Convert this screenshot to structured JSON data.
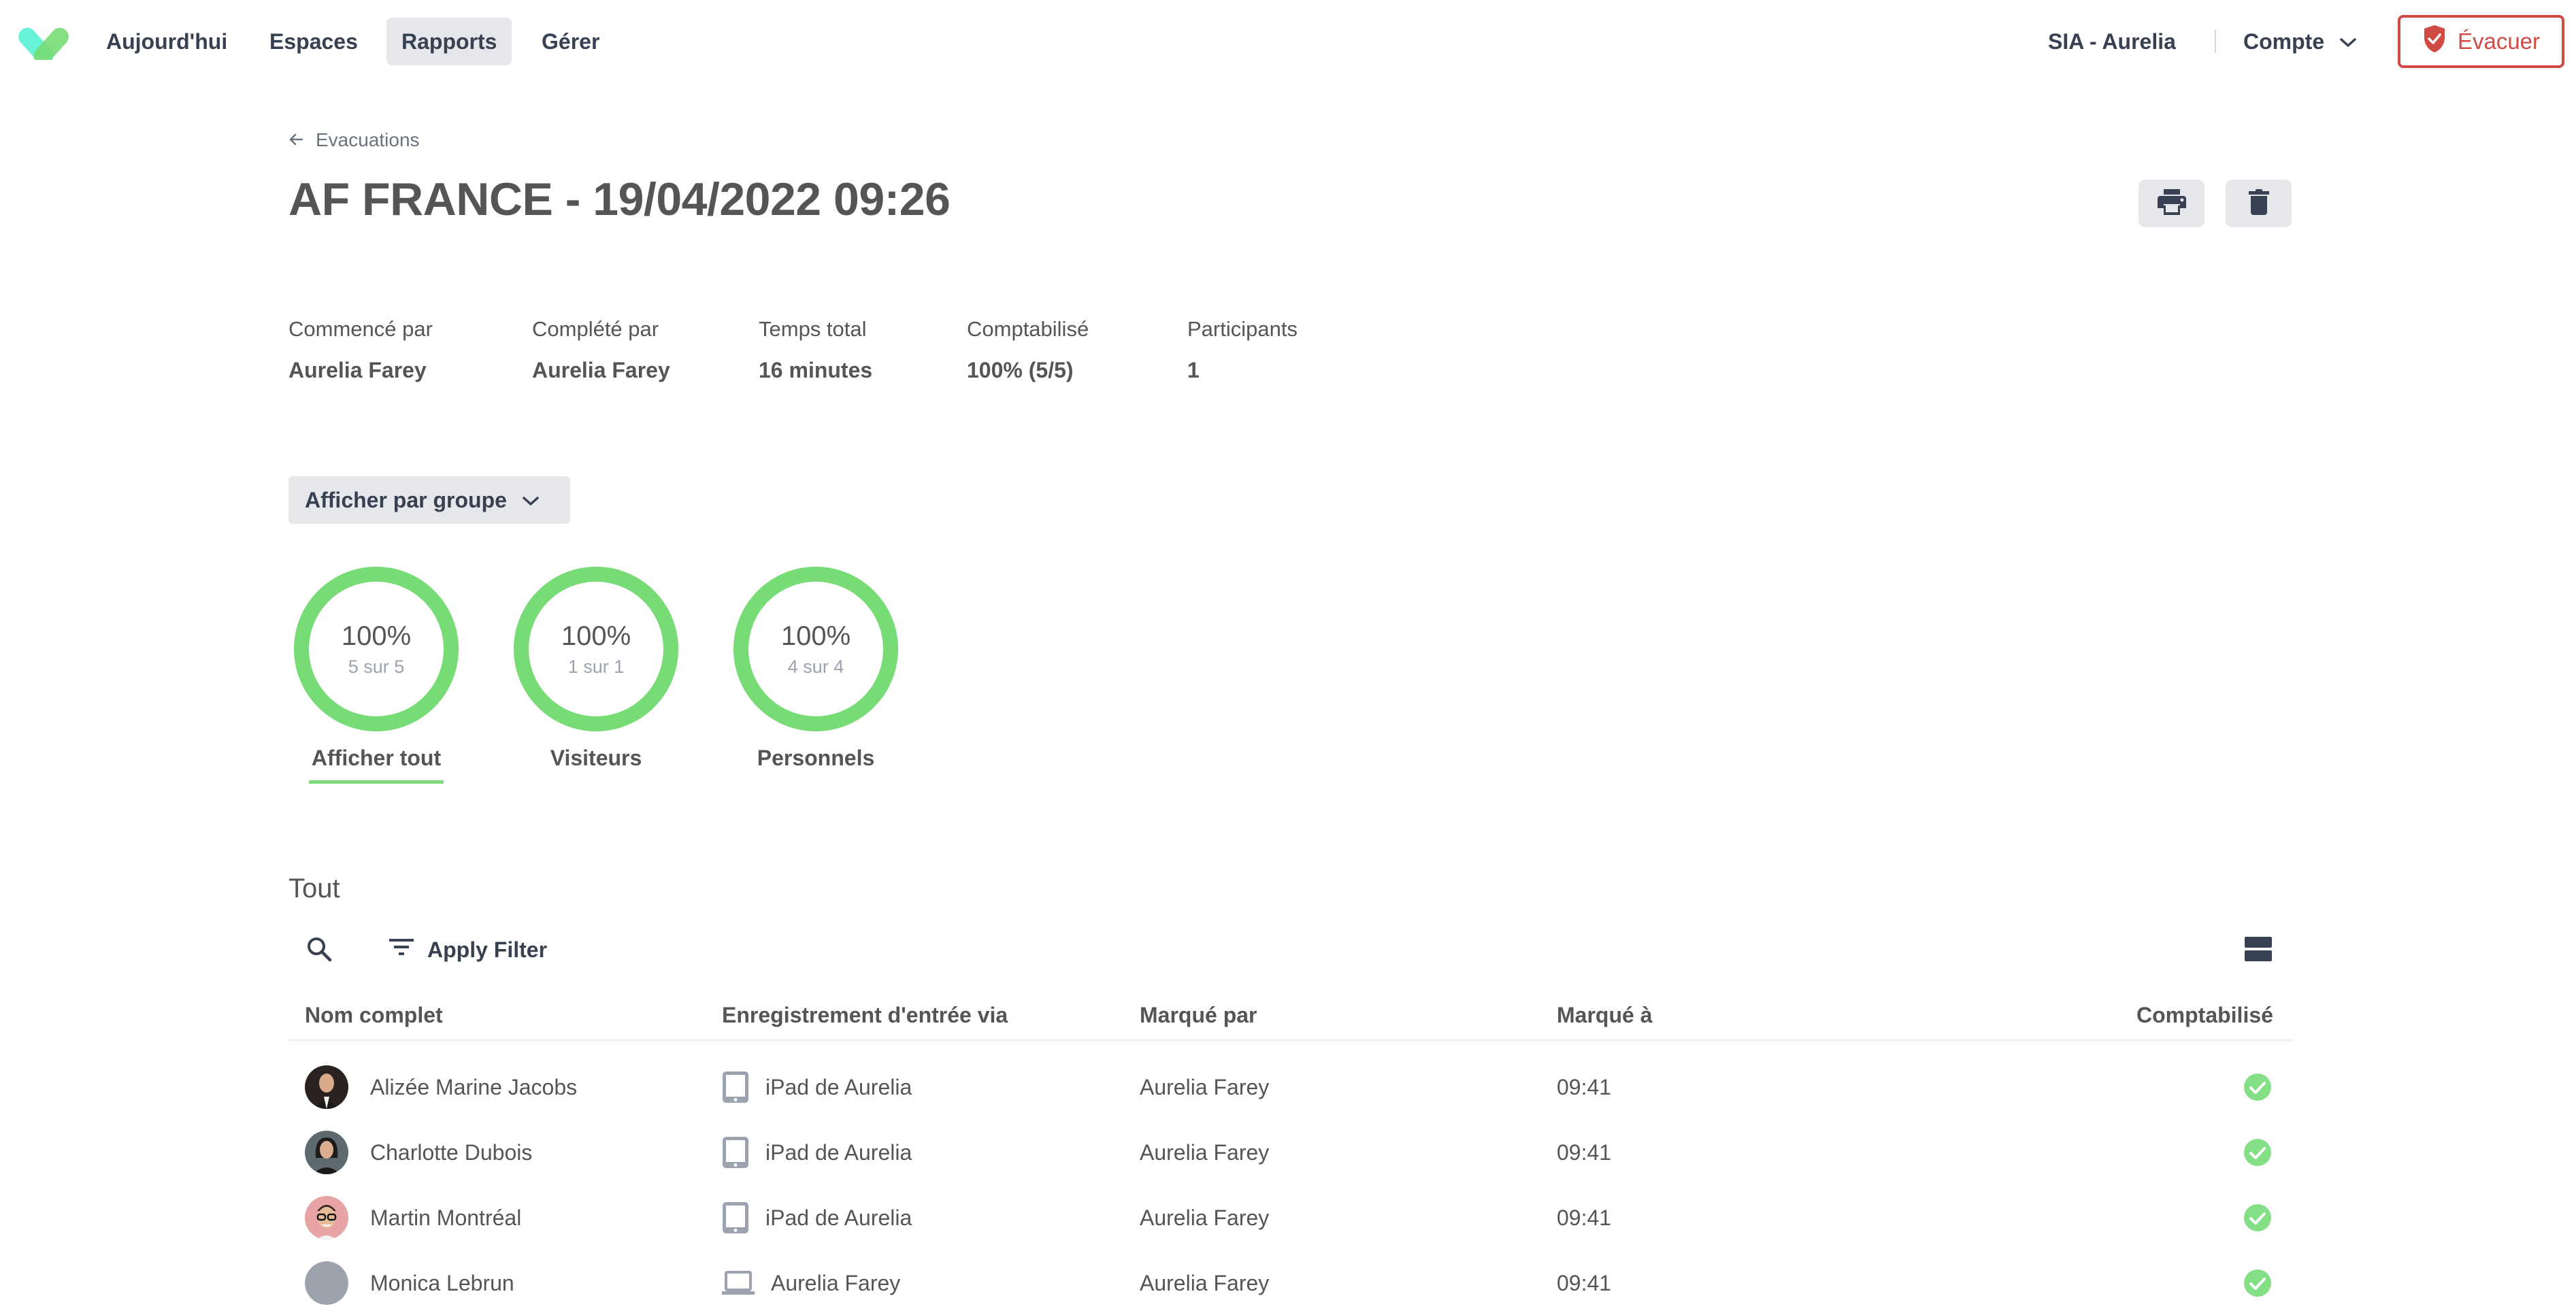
{
  "nav": {
    "logo": "app-logo",
    "items": [
      {
        "label": "Aujourd'hui",
        "active": false
      },
      {
        "label": "Espaces",
        "active": false
      },
      {
        "label": "Rapports",
        "active": true
      },
      {
        "label": "Gérer",
        "active": false
      }
    ],
    "org_name": "SIA - Aurelia",
    "account_label": "Compte",
    "evacuate_label": "Évacuer",
    "evacuate_color": "#d14b45"
  },
  "header": {
    "breadcrumb": "Evacuations",
    "title": "AF FRANCE - 19/04/2022 09:26",
    "actions": [
      "print-icon",
      "trash-icon"
    ]
  },
  "stats": [
    {
      "label": "Commencé par",
      "value": "Aurelia Farey"
    },
    {
      "label": "Complété par",
      "value": "Aurelia Farey"
    },
    {
      "label": "Temps total",
      "value": "16 minutes"
    },
    {
      "label": "Comptabilisé",
      "value": "100% (5/5)"
    },
    {
      "label": "Participants",
      "value": "1"
    }
  ],
  "group_dropdown": {
    "label": "Afficher par groupe"
  },
  "groups": [
    {
      "label": "Afficher tout",
      "percent": "100%",
      "count": "5 sur 5",
      "progress": 1.0,
      "selected": true
    },
    {
      "label": "Visiteurs",
      "percent": "100%",
      "count": "1 sur 1",
      "progress": 1.0,
      "selected": false
    },
    {
      "label": "Personnels",
      "percent": "100%",
      "count": "4 sur 4",
      "progress": 1.0,
      "selected": false
    }
  ],
  "accent_green": "#77dc75",
  "table": {
    "title": "Tout",
    "filter_label": "Apply Filter",
    "columns": [
      "Nom complet",
      "Enregistrement d'entrée via",
      "Marqué par",
      "Marqué à",
      "Comptabilisé"
    ],
    "rows": [
      {
        "name": "Alizée Marine Jacobs",
        "avatar": "photo",
        "device_icon": "tablet-icon",
        "device": "iPad de Aurelia",
        "marked_by": "Aurelia Farey",
        "marked_at": "09:41",
        "accounted": true
      },
      {
        "name": "Charlotte Dubois",
        "avatar": "photo",
        "device_icon": "tablet-icon",
        "device": "iPad de Aurelia",
        "marked_by": "Aurelia Farey",
        "marked_at": "09:41",
        "accounted": true
      },
      {
        "name": "Martin Montréal",
        "avatar": "photo",
        "device_icon": "tablet-icon",
        "device": "iPad de Aurelia",
        "marked_by": "Aurelia Farey",
        "marked_at": "09:41",
        "accounted": true
      },
      {
        "name": "Monica Lebrun",
        "avatar": "placeholder",
        "device_icon": "laptop-icon",
        "device": "Aurelia Farey",
        "marked_by": "Aurelia Farey",
        "marked_at": "09:41",
        "accounted": true
      }
    ]
  }
}
